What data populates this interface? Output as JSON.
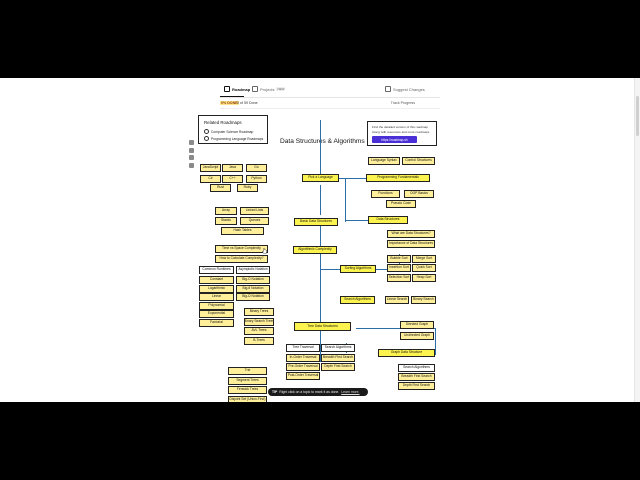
{
  "tabs": [
    {
      "label": "Roadmap"
    },
    {
      "label": "Projects",
      "badge": "NEW"
    },
    {
      "label": "Suggest Changes"
    }
  ],
  "progress": {
    "percent": "0% DONE",
    "text": "0 of 59 Done",
    "track": "Track Progress"
  },
  "related": {
    "title": "Related Roadmaps",
    "items": [
      "Computer Science Roadmap",
      "Programming Language Roadmaps"
    ]
  },
  "find": {
    "lines": [
      "Find the detailed version of this roadmap",
      "Along with resources and more roadmaps"
    ],
    "button": "https://roadmap.sh"
  },
  "title": "Data Structures & Algorithms",
  "nodes": {
    "pick_language": "Pick a Language",
    "langs": [
      "JavaScript",
      "Java",
      "Go",
      "C#",
      "C++",
      "Python",
      "Rust",
      "Ruby"
    ],
    "language_syntax": "Language Syntax",
    "control_structures": "Control Structures",
    "programming_fundamentals": "Programming Fundamentals",
    "functions": "Functions",
    "oop_basics": "OOP Basics",
    "pseudo_code": "Pseudo Code",
    "basic_ds": "Basic Data Structures",
    "ds_items": [
      "Array",
      "Linked Lists",
      "Stacks",
      "Queues",
      "Hash Tables"
    ],
    "data_structures": "Data Structures",
    "what_are_ds": "What are Data Structures?",
    "importance_ds": "Importance of Data Structures",
    "complexity_items": [
      "Time vs Space Complexity",
      "How to Calculate Complexity?"
    ],
    "algorithmic_complexity": "Algorithmic Complexity",
    "common_runtimes": "Common Runtimes",
    "runtimes": [
      "Constant",
      "Logarithmic",
      "Linear",
      "Polynomial",
      "Exponential",
      "Factorial"
    ],
    "asymptotic": "Asymptotic Notation",
    "notations": [
      "Big-O Notation",
      "Big-θ Notation",
      "Big-Ω Notation"
    ],
    "sorting_algorithms": "Sorting Algorithms",
    "sorts": [
      "Bubble Sort",
      "Merge Sort",
      "Insertion Sort",
      "Quick Sort",
      "Selection Sort",
      "Heap Sort"
    ],
    "search_algorithms": "Search Algorithms",
    "linear_search": "Linear Search",
    "binary_search": "Binary Search",
    "trees_left": [
      "Binary Trees",
      "Binary Search Trees",
      "AVL Trees",
      "B-Trees"
    ],
    "tree_ds": "Tree Data Structures",
    "tree_traversal": "Tree Traversal",
    "traversals": [
      "In-Order Traversal",
      "Pre-Order Traversal",
      "Post-Order Traversal"
    ],
    "tree_search": "Search Algorithms",
    "tree_search_items": [
      "Breadth First Search",
      "Depth First Search"
    ],
    "directed_graph": "Directed Graph",
    "undirected_graph": "Undirected Graph",
    "graph_ds": "Graph Data Structure",
    "graph_search": "Search Algorithms",
    "graph_search_items": [
      "Breadth First Search",
      "Depth First Search"
    ],
    "advanced_trees": [
      "Trie",
      "Segment Trees",
      "Fenwick Trees",
      "Disjoint Set (Union-Find)"
    ]
  },
  "tip": {
    "label": "TIP",
    "text": "Right click on a topic to mark it as done.",
    "link": "Learn more."
  },
  "colors": {
    "main": "#fdf34f",
    "sub": "#ffef9a",
    "line": "#2b6ea8",
    "button": "#4b2fd6"
  }
}
